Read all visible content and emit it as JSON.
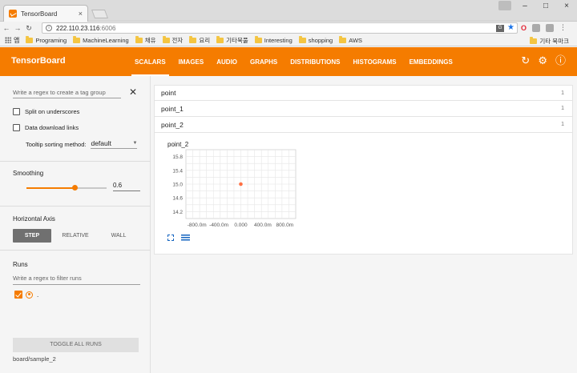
{
  "browser": {
    "tab_title": "TensorBoard",
    "tab_close": "×",
    "window_controls": [
      "–",
      "□",
      "×"
    ],
    "url_host": "222.110.23.116",
    "url_port": ":6006",
    "bookmarks_apps_label": "앱",
    "bookmarks": [
      "Programing",
      "MachineLearning",
      "채유",
      "전자",
      "요리",
      "기타북풀",
      "Interesting",
      "shopping",
      "AWS"
    ],
    "other_bookmarks": "기타 북마크"
  },
  "header": {
    "title": "TensorBoard",
    "tabs": [
      {
        "label": "SCALARS",
        "active": true
      },
      {
        "label": "IMAGES",
        "active": false
      },
      {
        "label": "AUDIO",
        "active": false
      },
      {
        "label": "GRAPHS",
        "active": false
      },
      {
        "label": "DISTRIBUTIONS",
        "active": false
      },
      {
        "label": "HISTOGRAMS",
        "active": false
      },
      {
        "label": "EMBEDDINGS",
        "active": false
      }
    ],
    "accent": "#f57c00"
  },
  "sidebar": {
    "tag_filter_placeholder": "Write a regex to create a tag group",
    "split_label": "Split on underscores",
    "download_label": "Data download links",
    "tooltip_label": "Tooltip sorting method:",
    "tooltip_value": "default",
    "smoothing_title": "Smoothing",
    "smoothing_value": "0.6",
    "smoothing_fraction": 0.6,
    "axis_title": "Horizontal Axis",
    "axis_options": [
      {
        "label": "STEP",
        "active": true
      },
      {
        "label": "RELATIVE",
        "active": false
      },
      {
        "label": "WALL",
        "active": false
      }
    ],
    "runs_title": "Runs",
    "runs_filter_placeholder": "Write a regex to filter runs",
    "run_name": ".",
    "toggle_all": "TOGGLE ALL RUNS",
    "logdir": "board/sample_2"
  },
  "groups": [
    {
      "name": "point",
      "count": "1"
    },
    {
      "name": "point_1",
      "count": "1"
    },
    {
      "name": "point_2",
      "count": "1"
    }
  ],
  "chart_data": {
    "type": "scatter",
    "title": "point_2",
    "x_tick_labels": [
      "-800.0m",
      "-400.0m",
      "0.000",
      "400.0m",
      "800.0m"
    ],
    "y_tick_labels": [
      "15.8",
      "15.4",
      "15.0",
      "14.6",
      "14.2"
    ],
    "x_ticks": [
      -0.8,
      -0.4,
      0,
      0.4,
      0.8
    ],
    "y_ticks": [
      15.8,
      15.4,
      15.0,
      14.6,
      14.2
    ],
    "xlim": [
      -1.0,
      1.0
    ],
    "ylim": [
      14.0,
      16.0
    ],
    "points": [
      {
        "x": 0,
        "y": 15.0
      }
    ],
    "grid": true,
    "point_color": "#ff7043"
  }
}
